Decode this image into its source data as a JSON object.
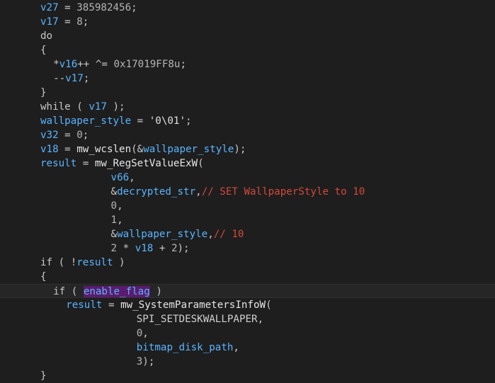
{
  "code_lines": [
    {
      "indent": 0,
      "tokens": [
        {
          "t": "id",
          "v": "v27"
        },
        {
          "t": "op",
          "v": " = "
        },
        {
          "t": "num",
          "v": "385982456"
        },
        {
          "t": "op",
          "v": ";"
        }
      ]
    },
    {
      "indent": 0,
      "tokens": [
        {
          "t": "id",
          "v": "v17"
        },
        {
          "t": "op",
          "v": " = "
        },
        {
          "t": "num",
          "v": "8"
        },
        {
          "t": "op",
          "v": ";"
        }
      ]
    },
    {
      "indent": 0,
      "tokens": [
        {
          "t": "kw",
          "v": "do"
        }
      ]
    },
    {
      "indent": 0,
      "tokens": [
        {
          "t": "op",
          "v": "{"
        }
      ]
    },
    {
      "indent": 2,
      "tokens": [
        {
          "t": "op",
          "v": "*"
        },
        {
          "t": "id",
          "v": "v16"
        },
        {
          "t": "op",
          "v": "++ ^= "
        },
        {
          "t": "num",
          "v": "0x17019FF8u"
        },
        {
          "t": "op",
          "v": ";"
        }
      ]
    },
    {
      "indent": 2,
      "tokens": [
        {
          "t": "op",
          "v": "--"
        },
        {
          "t": "id",
          "v": "v17"
        },
        {
          "t": "op",
          "v": ";"
        }
      ]
    },
    {
      "indent": 0,
      "tokens": [
        {
          "t": "op",
          "v": "}"
        }
      ]
    },
    {
      "indent": 0,
      "tokens": [
        {
          "t": "kw",
          "v": "while"
        },
        {
          "t": "op",
          "v": " ( "
        },
        {
          "t": "id",
          "v": "v17"
        },
        {
          "t": "op",
          "v": " );"
        }
      ]
    },
    {
      "indent": 0,
      "tokens": [
        {
          "t": "id",
          "v": "wallpaper_style"
        },
        {
          "t": "op",
          "v": " = "
        },
        {
          "t": "str",
          "v": "'0\\01'"
        },
        {
          "t": "op",
          "v": ";"
        }
      ]
    },
    {
      "indent": 0,
      "tokens": [
        {
          "t": "id",
          "v": "v32"
        },
        {
          "t": "op",
          "v": " = "
        },
        {
          "t": "num",
          "v": "0"
        },
        {
          "t": "op",
          "v": ";"
        }
      ]
    },
    {
      "indent": 0,
      "tokens": [
        {
          "t": "id",
          "v": "v18"
        },
        {
          "t": "op",
          "v": " = "
        },
        {
          "t": "fn",
          "v": "mw_wcslen"
        },
        {
          "t": "op",
          "v": "(&"
        },
        {
          "t": "id",
          "v": "wallpaper_style"
        },
        {
          "t": "op",
          "v": ");"
        }
      ]
    },
    {
      "indent": 0,
      "tokens": [
        {
          "t": "id",
          "v": "result"
        },
        {
          "t": "op",
          "v": " = "
        },
        {
          "t": "fn",
          "v": "mw_RegSetValueExW"
        },
        {
          "t": "op",
          "v": "("
        }
      ]
    },
    {
      "indent": 11,
      "tokens": [
        {
          "t": "id",
          "v": "v66"
        },
        {
          "t": "op",
          "v": ","
        }
      ]
    },
    {
      "indent": 11,
      "tokens": [
        {
          "t": "op",
          "v": "&"
        },
        {
          "t": "id",
          "v": "decrypted_str"
        },
        {
          "t": "op",
          "v": ","
        },
        {
          "t": "cm",
          "v": "// SET WallpaperStyle to 10"
        }
      ]
    },
    {
      "indent": 11,
      "tokens": [
        {
          "t": "num",
          "v": "0"
        },
        {
          "t": "op",
          "v": ","
        }
      ]
    },
    {
      "indent": 11,
      "tokens": [
        {
          "t": "num",
          "v": "1"
        },
        {
          "t": "op",
          "v": ","
        }
      ]
    },
    {
      "indent": 11,
      "tokens": [
        {
          "t": "op",
          "v": "&"
        },
        {
          "t": "id",
          "v": "wallpaper_style"
        },
        {
          "t": "op",
          "v": ","
        },
        {
          "t": "cm",
          "v": "// 10"
        }
      ]
    },
    {
      "indent": 11,
      "tokens": [
        {
          "t": "num",
          "v": "2"
        },
        {
          "t": "op",
          "v": " * "
        },
        {
          "t": "id",
          "v": "v18"
        },
        {
          "t": "op",
          "v": " + "
        },
        {
          "t": "num",
          "v": "2"
        },
        {
          "t": "op",
          "v": ");"
        }
      ]
    },
    {
      "indent": 0,
      "tokens": [
        {
          "t": "kw",
          "v": "if"
        },
        {
          "t": "op",
          "v": " ( !"
        },
        {
          "t": "id",
          "v": "result"
        },
        {
          "t": "op",
          "v": " )"
        }
      ]
    },
    {
      "indent": 0,
      "tokens": [
        {
          "t": "op",
          "v": "{"
        }
      ]
    },
    {
      "indent": 2,
      "current": true,
      "tokens": [
        {
          "t": "kw",
          "v": "if"
        },
        {
          "t": "op",
          "v": " ( "
        },
        {
          "t": "hl",
          "v": "enable_flag"
        },
        {
          "t": "op",
          "v": " )"
        }
      ]
    },
    {
      "indent": 4,
      "tokens": [
        {
          "t": "id",
          "v": "result"
        },
        {
          "t": "op",
          "v": " = "
        },
        {
          "t": "fn",
          "v": "mw_SystemParametersInfoW"
        },
        {
          "t": "op",
          "v": "("
        }
      ]
    },
    {
      "indent": 15,
      "tokens": [
        {
          "t": "const",
          "v": "SPI_SETDESKWALLPAPER"
        },
        {
          "t": "op",
          "v": ","
        }
      ]
    },
    {
      "indent": 15,
      "tokens": [
        {
          "t": "num",
          "v": "0"
        },
        {
          "t": "op",
          "v": ","
        }
      ]
    },
    {
      "indent": 15,
      "tokens": [
        {
          "t": "id",
          "v": "bitmap_disk_path"
        },
        {
          "t": "op",
          "v": ","
        }
      ]
    },
    {
      "indent": 15,
      "tokens": [
        {
          "t": "num",
          "v": "3"
        },
        {
          "t": "op",
          "v": ");"
        }
      ]
    },
    {
      "indent": 0,
      "tokens": [
        {
          "t": "op",
          "v": "}"
        }
      ]
    }
  ],
  "colors": {
    "background": "#1e1e1e",
    "identifier": "#5ab4ff",
    "comment": "#d4493a",
    "highlight": "#5a1c6e"
  }
}
